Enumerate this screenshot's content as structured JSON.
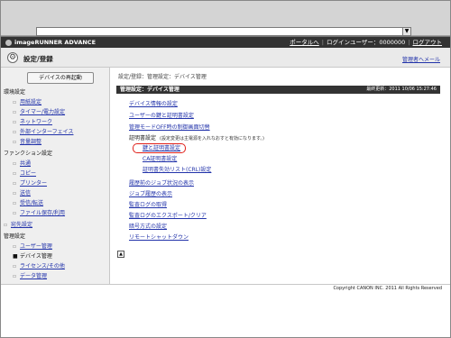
{
  "header": {
    "brand": "imageRUNNER ADVANCE",
    "portal_link": "ポータルへ",
    "login_user_label": "ログインユーザー：0000000",
    "logout_link": "ログアウト"
  },
  "titlebar": {
    "title": "設定/登録",
    "mail_link": "管理者へメール"
  },
  "sidebar": {
    "restart_button": "デバイスの再起動",
    "groups": [
      {
        "heading": "環境設定",
        "items": [
          "用紙設定",
          "タイマー/電力設定",
          "ネットワーク",
          "外部インターフェイス",
          "音量調整"
        ]
      },
      {
        "heading": "ファンクション設定",
        "items": [
          "共通",
          "コピー",
          "プリンター",
          "送信",
          "受信/転送",
          "ファイル保存/利用"
        ]
      }
    ],
    "standalone": [
      "宛先設定"
    ],
    "mgmt": {
      "heading": "管理設定",
      "items": [
        "ユーザー管理",
        "デバイス管理",
        "ライセンス/その他",
        "データ管理"
      ],
      "active_index": 1
    }
  },
  "main": {
    "breadcrumb": "設定/登録：管理設定：デバイス管理",
    "section_title": "管理設定：デバイス管理",
    "updated": "最終更新：2011 10/06 15:27:46",
    "links": {
      "device_info": "デバイス情報の設定",
      "user_key_cert": "ユーザーの鍵と証明書設定",
      "mgmt_off_switch": "管理モードOFF時の制御画面切替"
    },
    "cert_settings": {
      "label": "証明書設定",
      "note": "(設定変更は主電源を入れなおすと有効になります。)",
      "items": [
        "鍵と証明書設定",
        "CA証明書設定",
        "証明書失効リスト(CRL)設定"
      ]
    },
    "links2": {
      "recent_job_status": "履歴前のジョブ状況の表示",
      "job_history": "ジョブ履歴の表示",
      "audit_log_get": "監査ログの取得",
      "audit_log_export": "監査ログのエクスポート/クリア",
      "encryption": "暗号方式の設定",
      "remote_shutdown": "リモートシャットダウン"
    },
    "top_icon_label": "▲"
  },
  "footer": {
    "copyright": "Copyright CANON INC. 2011 All Rights Reserved"
  },
  "colors": {
    "header_bg": "#333333",
    "link": "#2233aa",
    "highlight_ring": "#e0201a"
  }
}
